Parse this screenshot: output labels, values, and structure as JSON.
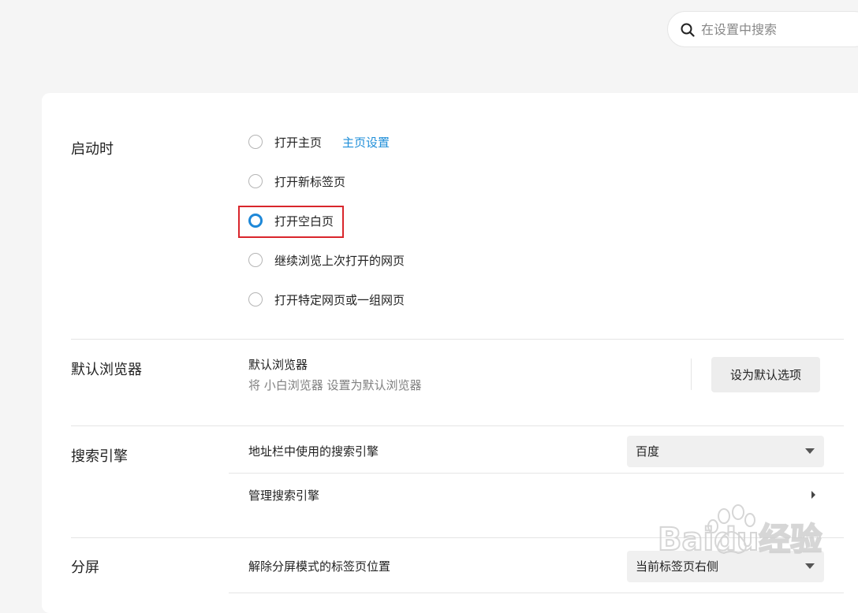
{
  "search": {
    "placeholder": "在设置中搜索"
  },
  "startup": {
    "title": "启动时",
    "options": [
      {
        "label": "打开主页",
        "link": "主页设置"
      },
      {
        "label": "打开新标签页"
      },
      {
        "label": "打开空白页",
        "selected": true
      },
      {
        "label": "继续浏览上次打开的网页"
      },
      {
        "label": "打开特定网页或一组网页"
      }
    ]
  },
  "default_browser": {
    "title": "默认浏览器",
    "heading": "默认浏览器",
    "description": "将 小白浏览器 设置为默认浏览器",
    "button": "设为默认选项"
  },
  "search_engine": {
    "title": "搜索引擎",
    "address_bar_label": "地址栏中使用的搜索引擎",
    "selected_engine": "百度",
    "manage_label": "管理搜索引擎"
  },
  "split_screen": {
    "title": "分屏",
    "tab_position_label": "解除分屏模式的标签页位置",
    "selected_position": "当前标签页右侧"
  },
  "watermark": {
    "text": "Baidu经验"
  },
  "colors": {
    "accent": "#1e88d8",
    "highlight": "#d9262c",
    "link": "#1e8ed8"
  }
}
